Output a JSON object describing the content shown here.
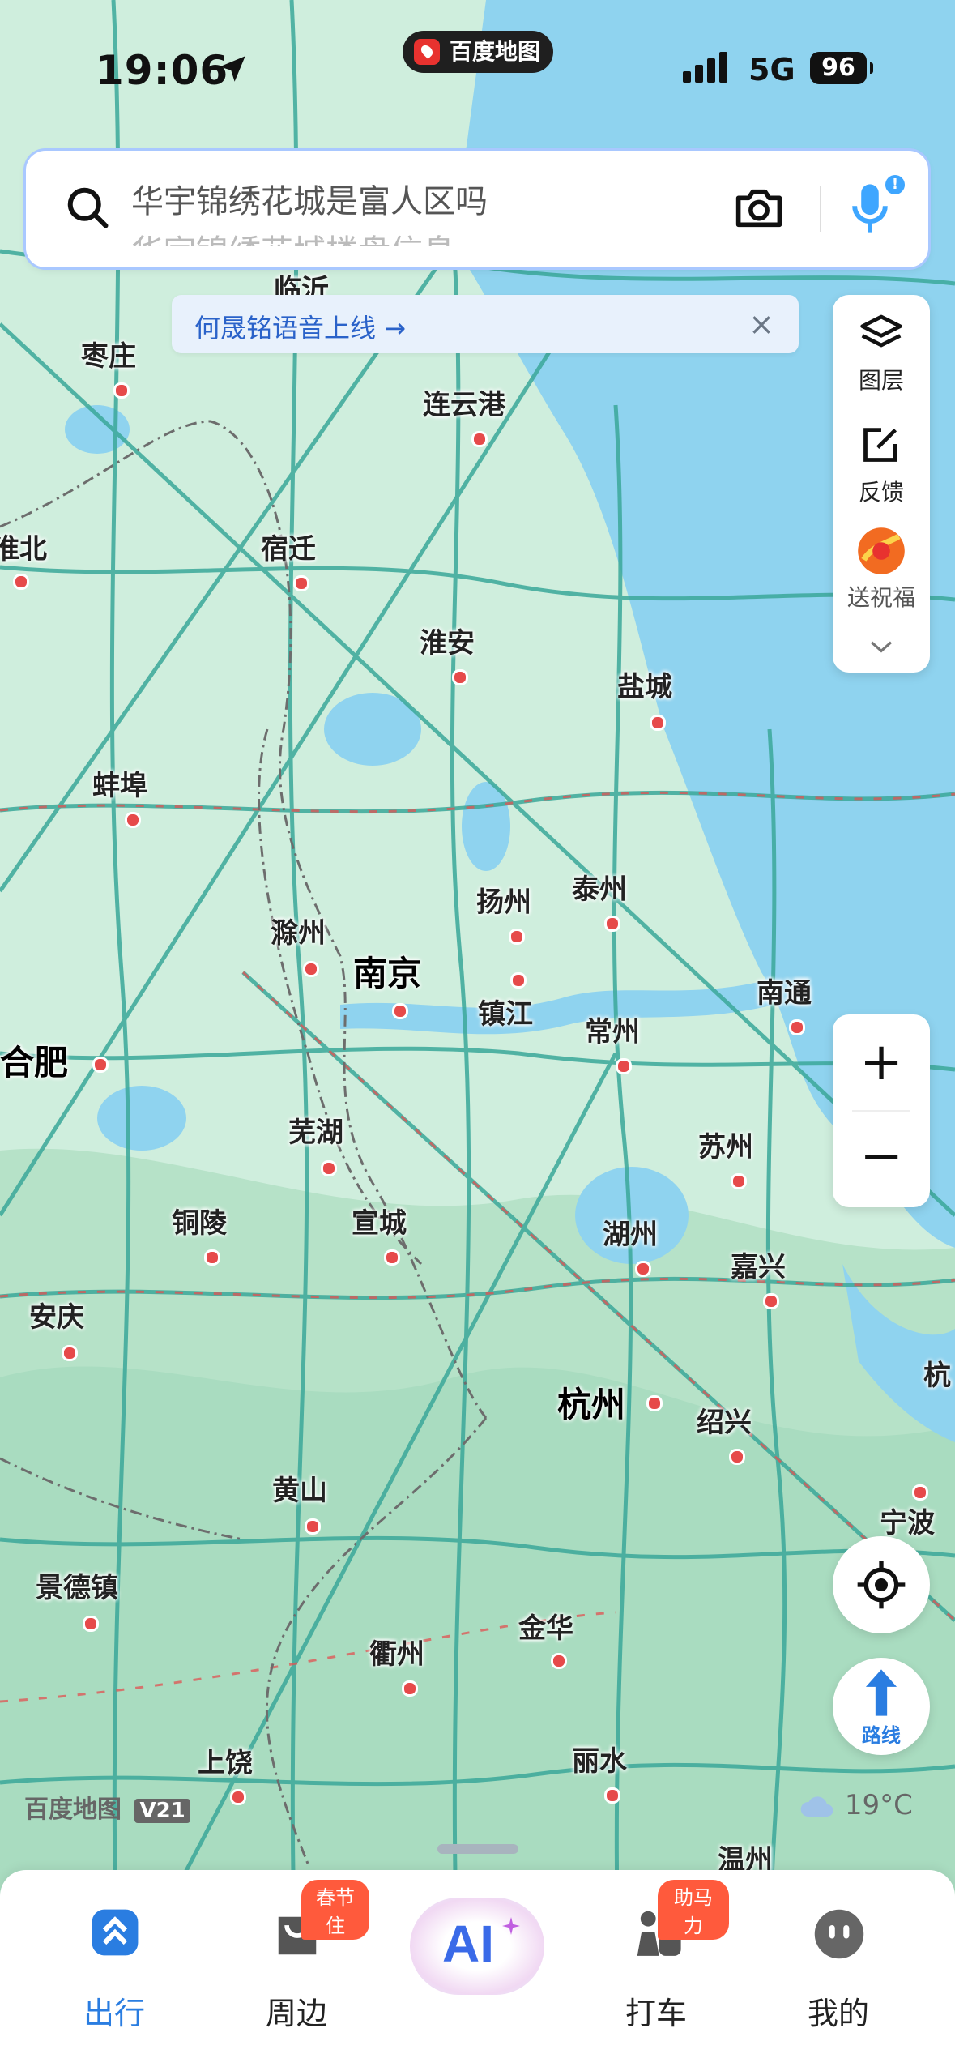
{
  "status_bar": {
    "time": "19:06",
    "app_name": "百度地图",
    "network": "5G",
    "battery": "96"
  },
  "search": {
    "placeholder": "华宇锦绣花城是富人区吗",
    "sub_text": "华宇锦绣花城楼盘信息"
  },
  "banner": {
    "text": "何晟铭语音上线 →",
    "close": "×"
  },
  "side_panel": {
    "layers_label": "图层",
    "feedback_label": "反馈",
    "greeting_label": "送祝福"
  },
  "zoom": {
    "plus": "+",
    "minus": "−"
  },
  "route_button": {
    "label": "路线"
  },
  "map_footer": {
    "scale_text": "百度地图",
    "version": "V21",
    "weather": "19°C"
  },
  "cities": [
    {
      "name": "临沂",
      "big": false
    },
    {
      "name": "枣庄",
      "big": false
    },
    {
      "name": "连云港",
      "big": false
    },
    {
      "name": "淮北",
      "big": false
    },
    {
      "name": "宿迁",
      "big": false
    },
    {
      "name": "淮安",
      "big": false
    },
    {
      "name": "盐城",
      "big": false
    },
    {
      "name": "蚌埠",
      "big": false
    },
    {
      "name": "扬州",
      "big": false
    },
    {
      "name": "泰州",
      "big": false
    },
    {
      "name": "滁州",
      "big": false
    },
    {
      "name": "南京",
      "big": true
    },
    {
      "name": "镇江",
      "big": false
    },
    {
      "name": "常州",
      "big": false
    },
    {
      "name": "南通",
      "big": false
    },
    {
      "name": "合肥",
      "big": true
    },
    {
      "name": "芜湖",
      "big": false
    },
    {
      "name": "苏州",
      "big": false
    },
    {
      "name": "铜陵",
      "big": false
    },
    {
      "name": "宣城",
      "big": false
    },
    {
      "name": "湖州",
      "big": false
    },
    {
      "name": "嘉兴",
      "big": false
    },
    {
      "name": "安庆",
      "big": false
    },
    {
      "name": "杭州",
      "big": true
    },
    {
      "name": "绍兴",
      "big": false
    },
    {
      "name": "黄山",
      "big": false
    },
    {
      "name": "宁波",
      "big": false
    },
    {
      "name": "景德镇",
      "big": false
    },
    {
      "name": "金华",
      "big": false
    },
    {
      "name": "衢州",
      "big": false
    },
    {
      "name": "上饶",
      "big": false
    },
    {
      "name": "丽水",
      "big": false
    },
    {
      "name": "温州",
      "big": false
    },
    {
      "name": "杭",
      "big": false
    }
  ],
  "bottom_nav": [
    {
      "label": "出行",
      "badge": "",
      "active": true
    },
    {
      "label": "周边",
      "badge": "春节住",
      "active": false
    },
    {
      "label": "AI",
      "badge": "",
      "active": false
    },
    {
      "label": "打车",
      "badge": "助马力",
      "active": false
    },
    {
      "label": "我的",
      "badge": "",
      "active": false
    }
  ],
  "colors": {
    "land": "#cfeedd",
    "mountain": "#a9dcc0",
    "water": "#8fd3ef",
    "road": "#3ba89a",
    "traffic": "#e15252",
    "accent": "#2a7de1"
  }
}
